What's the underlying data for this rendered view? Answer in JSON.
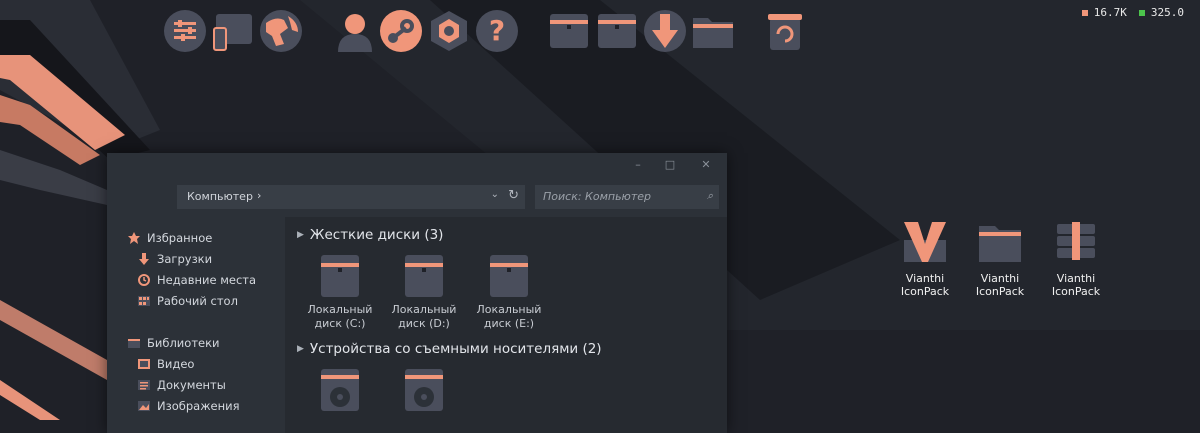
{
  "colors": {
    "accent": "#f0967a",
    "bg": "#1f2128",
    "panel": "#2c3138",
    "icon_body": "#4a4e5c"
  },
  "dock": {
    "icons": [
      "settings-sliders-icon",
      "phone-tablet-icon",
      "earth-globe-icon",
      "user-icon",
      "steam-icon",
      "gear-nut-icon",
      "help-icon",
      "drive-icon",
      "drive-icon",
      "download-icon",
      "folder-icon",
      "recycle-bin-icon"
    ]
  },
  "stats": {
    "value1": "16.7K",
    "value2": "325.0"
  },
  "desktop": {
    "icons": [
      {
        "label": "Vianthi IconPack"
      },
      {
        "label": "Vianthi IconPack"
      },
      {
        "label": "Vianthi IconPack"
      }
    ]
  },
  "window": {
    "controls": {
      "minimize": "–",
      "maximize": "□",
      "close": "✕"
    },
    "address": {
      "text": "Компьютер",
      "chevron": "›",
      "dropdown": "⌄",
      "refresh": "↻"
    },
    "search": {
      "placeholder": "Поиск: Компьютер",
      "icon": "⌕"
    },
    "nav": {
      "favorites": {
        "label": "Избранное"
      },
      "items1": [
        "Загрузки",
        "Недавние места",
        "Рабочий стол"
      ],
      "libraries": {
        "label": "Библиотеки"
      },
      "items2": [
        "Видео",
        "Документы",
        "Изображения"
      ]
    },
    "groups": [
      {
        "label": "Жесткие диски (3)",
        "arrow": "▶"
      },
      {
        "label": "Устройства со съемными носителями (2)",
        "arrow": "▶"
      }
    ],
    "drives": [
      "Локальный диск (C:)",
      "Локальный диск (D:)",
      "Локальный диск (E:)"
    ]
  }
}
